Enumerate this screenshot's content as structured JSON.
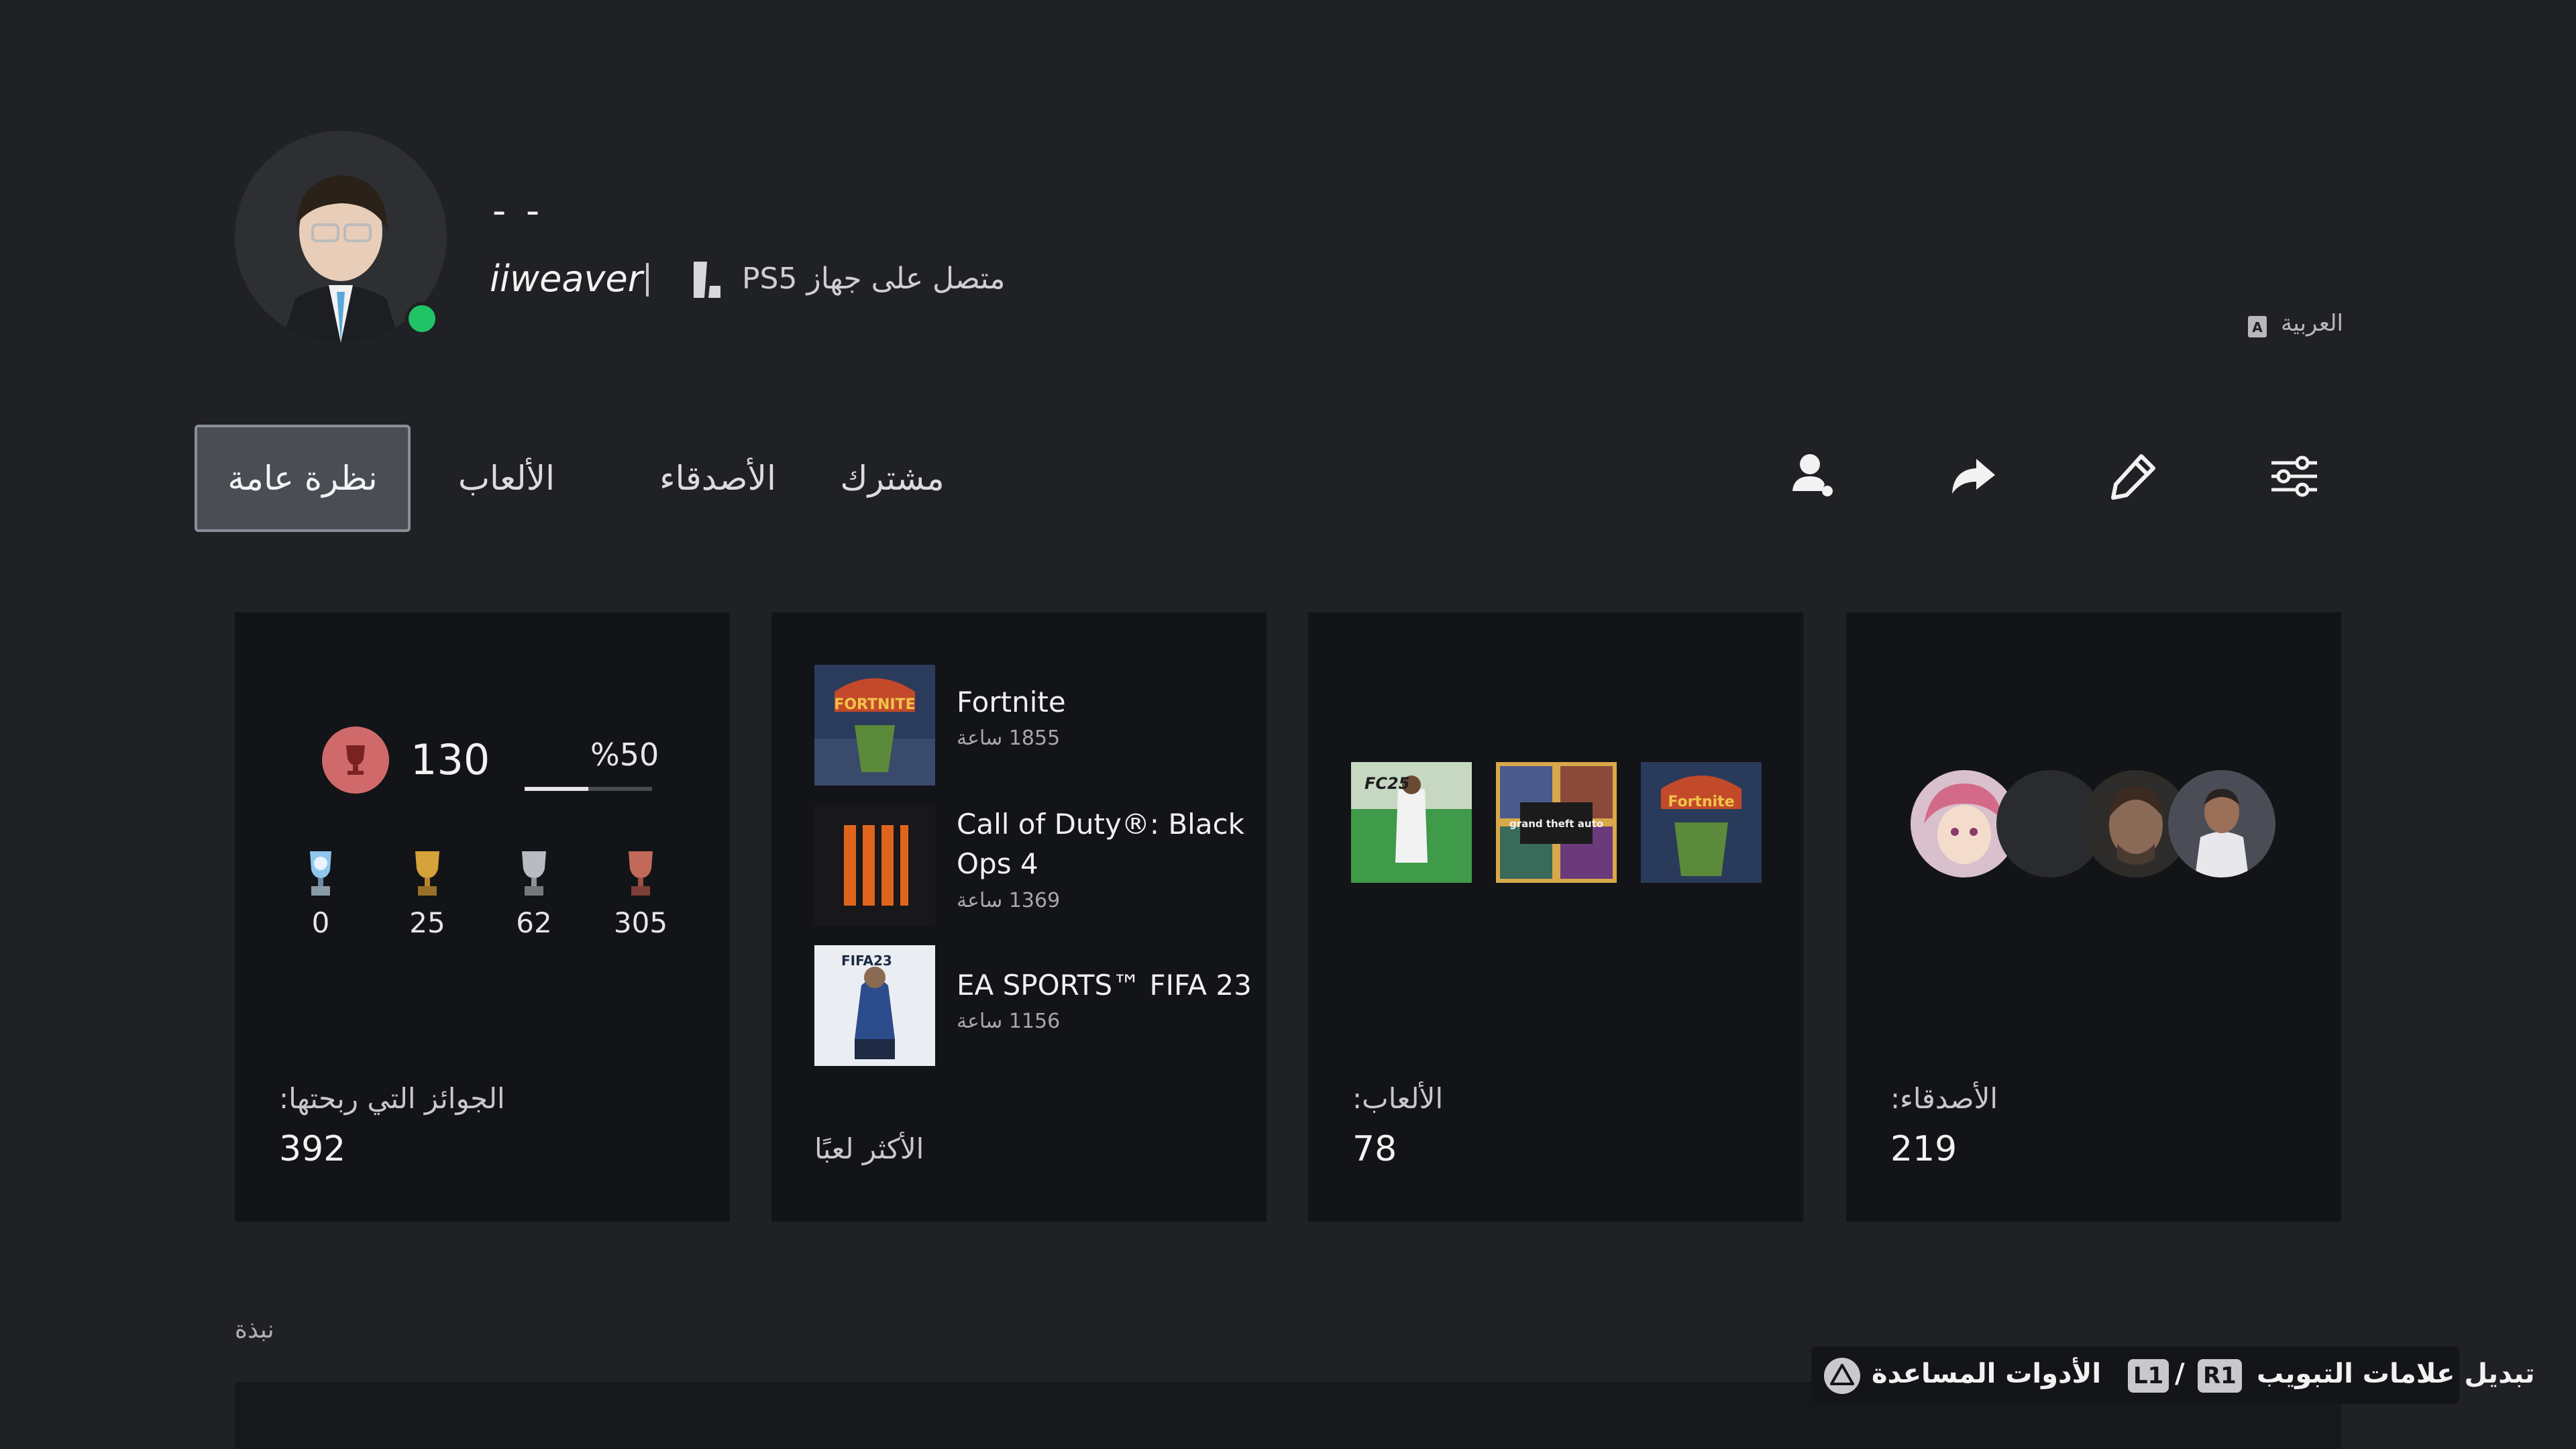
{
  "profile": {
    "display_name": "- -",
    "online_id": "iiweaver",
    "status": "متصل على جهاز PS5",
    "language": "العربية"
  },
  "tabs": [
    {
      "label": "نظرة عامة",
      "active": true
    },
    {
      "label": "الألعاب"
    },
    {
      "label": "الأصدقاء"
    },
    {
      "label": "مشترك"
    }
  ],
  "toolbar": {
    "icons": [
      "add-friend-icon",
      "share-icon",
      "edit-icon",
      "settings-icon"
    ]
  },
  "trophies": {
    "level": "130",
    "progress_text": "%50",
    "progress": 0.5,
    "counts": {
      "platinum": "0",
      "gold": "25",
      "silver": "62",
      "bronze": "305"
    },
    "label": "الجوائز التي ربحتها:",
    "total": "392"
  },
  "most_played": {
    "label": "الأكثر لعبًا",
    "games": [
      {
        "title": "Fortnite",
        "hours": "1855 ساعة"
      },
      {
        "title_line1": "Call of Duty®: Black",
        "title_line2": "Ops 4",
        "hours": "1369 ساعة"
      },
      {
        "title": "EA SPORTS™ FIFA 23",
        "hours": "1156 ساعة",
        "thumb_text": "FIFA23"
      }
    ]
  },
  "games": {
    "label": "الألعاب:",
    "count": "78",
    "thumbs": [
      "FC25",
      "grand theft auto",
      "Fortnite"
    ]
  },
  "friends": {
    "label": "الأصدقاء:",
    "count": "219"
  },
  "about": {
    "label": "نبذة"
  },
  "hints": {
    "switch_tabs": "تبديل علامات التبويب",
    "r1": "R1",
    "slash": "/",
    "l1": "L1",
    "tools": "الأدوات المساعدة"
  },
  "colors": {
    "background": "#202124",
    "card": "#131417",
    "online": "#20c466",
    "trophy_badge": "#d06a6a"
  }
}
